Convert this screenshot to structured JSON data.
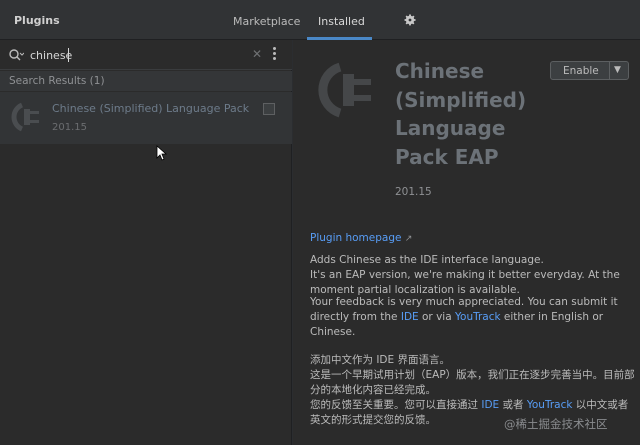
{
  "header": {
    "title": "Plugins",
    "tabs": [
      {
        "label": "Marketplace"
      },
      {
        "label": "Installed"
      }
    ]
  },
  "search": {
    "value": "chinese"
  },
  "results": {
    "header": "Search Results (1)",
    "items": [
      {
        "name": "Chinese (Simplified) Language Pack EAP",
        "version": "201.15"
      }
    ]
  },
  "detail": {
    "title_lines": [
      "Chinese",
      "(Simplified)",
      "Language",
      "Pack EAP"
    ],
    "version": "201.15",
    "enable_label": "Enable",
    "homepage_label": "Plugin homepage",
    "desc_1": "Adds Chinese as the IDE interface language.",
    "desc_2": "It's an EAP version, we're making it better everyday. At the moment partial localization is available.",
    "desc_3_pre": "Your feedback is very much appreciated. You can submit it directly from the ",
    "desc_3_link1": "IDE",
    "desc_3_mid": " or via ",
    "desc_3_link2": "YouTrack",
    "desc_3_post": " either in English or Chinese.",
    "desc_4": "添加中文作为 IDE 界面语言。",
    "desc_5": "这是一个早期试用计划（EAP）版本，我们正在逐步完善当中。目前部分的本地化内容已经完成。",
    "desc_6_pre": "您的反馈至关重要。您可以直接通过 ",
    "desc_6_link1": "IDE",
    "desc_6_mid": " 或者 ",
    "desc_6_link2": "YouTrack",
    "desc_6_post": " 以中文或者英文的形式提交您的反馈。"
  },
  "watermark": "@稀土掘金技术社区",
  "icons": {
    "search": "search-icon",
    "clear": "close-icon",
    "more": "kebab-menu-icon",
    "settings": "gear-icon",
    "plugin": "plug-icon",
    "external": "external-link-icon",
    "dropdown": "chevron-down-icon"
  },
  "colors": {
    "accent": "#4a88c7",
    "link": "#589df6",
    "background": "#2b2b2b"
  }
}
